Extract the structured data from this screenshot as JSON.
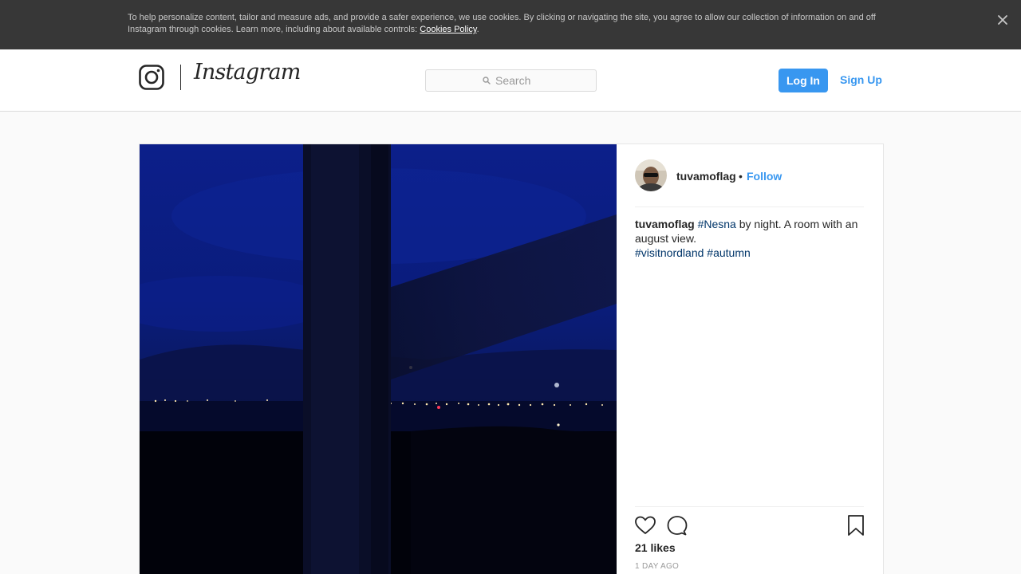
{
  "cookie_banner": {
    "text": "To help personalize content, tailor and measure ads, and provide a safer experience, we use cookies. By clicking or navigating the site, you agree to allow our collection of information on and off Instagram through cookies. Learn more, including about available controls: ",
    "link_label": "Cookies Policy",
    "end_punct": ".",
    "close_icon": "close-icon"
  },
  "header": {
    "logo_icon": "instagram-camera-icon",
    "wordmark": "Instagram",
    "search_placeholder": "Search",
    "search_icon": "search-icon",
    "login_label": "Log In",
    "signup_label": "Sign Up"
  },
  "post": {
    "author": "tuvamoflag",
    "separator": "•",
    "follow_label": "Follow",
    "caption": {
      "user": "tuvamoflag",
      "tag1": "#Nesna",
      "text": " by night. A room with an august view.",
      "tag2": "#visitnordland",
      "tag3": "#autumn"
    },
    "actions": {
      "like_icon": "heart-icon",
      "comment_icon": "comment-icon",
      "save_icon": "bookmark-icon"
    },
    "likes": "21 likes",
    "time": "1 DAY AGO"
  },
  "colors": {
    "accent": "#3897f0",
    "hashtag": "#003569",
    "banner_bg": "#373737"
  }
}
